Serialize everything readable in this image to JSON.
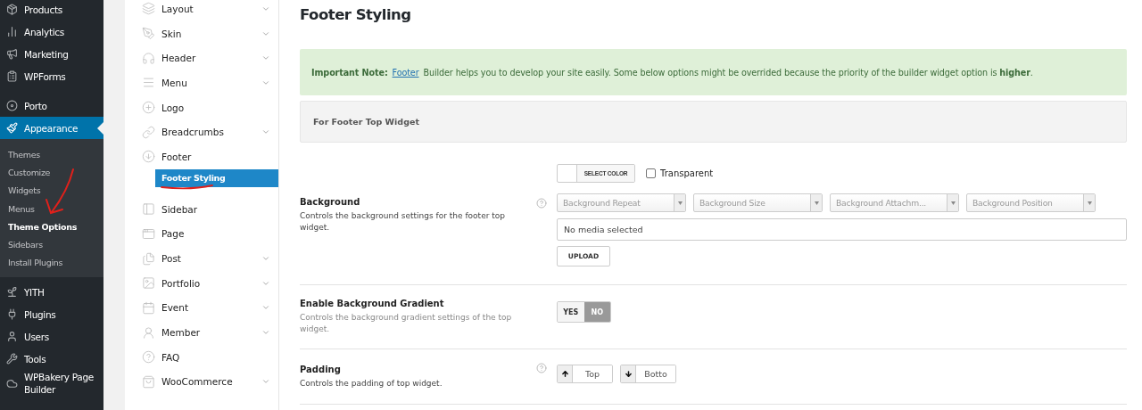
{
  "admin_menu": {
    "items": [
      {
        "label": "Products",
        "selected": false
      },
      {
        "label": "Analytics",
        "selected": false
      },
      {
        "label": "Marketing",
        "selected": false
      },
      {
        "label": "WPForms",
        "selected": false
      },
      {
        "label": "Porto",
        "selected": false
      },
      {
        "label": "Appearance",
        "selected": true,
        "children": [
          {
            "label": "Themes",
            "selected": false
          },
          {
            "label": "Customize",
            "selected": false
          },
          {
            "label": "Widgets",
            "selected": false
          },
          {
            "label": "Menus",
            "selected": false
          },
          {
            "label": "Theme Options",
            "selected": true
          },
          {
            "label": "Sidebars",
            "selected": false
          },
          {
            "label": "Install Plugins",
            "selected": false
          }
        ]
      },
      {
        "label": "YITH",
        "selected": false
      },
      {
        "label": "Plugins",
        "selected": false
      },
      {
        "label": "Users",
        "selected": false
      },
      {
        "label": "Tools",
        "selected": false
      },
      {
        "label": "WPBakery Page Builder",
        "selected": false
      }
    ]
  },
  "options_nav": {
    "items": [
      {
        "label": "Layout",
        "expandable": true,
        "selected": false
      },
      {
        "label": "Skin",
        "expandable": true,
        "selected": false
      },
      {
        "label": "Header",
        "expandable": true,
        "selected": false
      },
      {
        "label": "Menu",
        "expandable": true,
        "selected": false
      },
      {
        "label": "Logo",
        "expandable": false,
        "selected": false
      },
      {
        "label": "Breadcrumbs",
        "expandable": true,
        "selected": false
      },
      {
        "label": "Footer",
        "expandable": false,
        "selected": false,
        "children": [
          {
            "label": "Footer Styling",
            "selected": true
          }
        ]
      },
      {
        "label": "Sidebar",
        "expandable": false,
        "selected": false
      },
      {
        "label": "Page",
        "expandable": false,
        "selected": false
      },
      {
        "label": "Post",
        "expandable": true,
        "selected": false
      },
      {
        "label": "Portfolio",
        "expandable": true,
        "selected": false
      },
      {
        "label": "Event",
        "expandable": true,
        "selected": false
      },
      {
        "label": "Member",
        "expandable": true,
        "selected": false
      },
      {
        "label": "FAQ",
        "expandable": false,
        "selected": false
      },
      {
        "label": "WooCommerce",
        "expandable": true,
        "selected": false
      }
    ]
  },
  "page": {
    "title": "Footer Styling",
    "notice": {
      "before": "**Important Note:** ",
      "link": "Footer",
      "after": " Builder helps you to develop your site easily. Some below options might be overrided because the priority of the builder widget option is **higher**."
    },
    "section_heading": "For Footer Top Widget",
    "fields": [
      {
        "kind": "background",
        "label": "Background",
        "description": "Controls the background settings for the footer top widget.",
        "help": true,
        "color_button": "SELECT COLOR",
        "transparent": {
          "label": "Transparent",
          "checked": false
        },
        "selects": [
          {
            "placeholder": "Background Repeat"
          },
          {
            "placeholder": "Background Size"
          },
          {
            "placeholder": "Background Attachm..."
          },
          {
            "placeholder": "Background Position"
          }
        ],
        "media": {
          "placeholder": "No media selected"
        },
        "upload": "UPLOAD"
      },
      {
        "kind": "toggle",
        "label": "Enable Background Gradient",
        "description": "Controls the background gradient settings of the top widget.",
        "help": false,
        "options": [
          {
            "label": "YES",
            "selected": false
          },
          {
            "label": "NO",
            "selected": true
          }
        ]
      },
      {
        "kind": "dimensions",
        "label": "Padding",
        "description": "Controls the padding of top widget.",
        "help": true,
        "inputs": [
          {
            "placeholder": "Top"
          },
          {
            "placeholder": "Botto"
          }
        ]
      }
    ]
  }
}
